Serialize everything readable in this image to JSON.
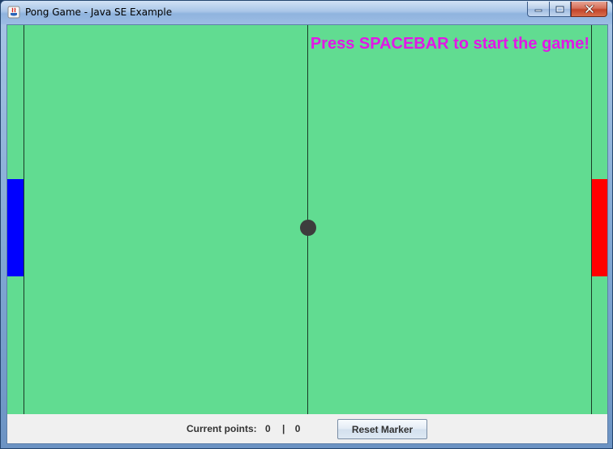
{
  "window": {
    "title": "Pong Game - Java SE Example"
  },
  "caption_buttons": {
    "minimize_icon": "minimize-icon",
    "maximize_icon": "maximize-icon",
    "close_icon": "close-icon"
  },
  "game": {
    "start_message": "Press SPACEBAR to start the game!",
    "court_color": "#61dc91",
    "left_paddle_color": "#0000ff",
    "right_paddle_color": "#ff0000",
    "ball_color": "#3d3d3d",
    "message_color": "#e117e6"
  },
  "status_bar": {
    "points_label": "Current points:",
    "player1_points": "0",
    "separator": "|",
    "player2_points": "0",
    "reset_button_label": "Reset Marker"
  }
}
